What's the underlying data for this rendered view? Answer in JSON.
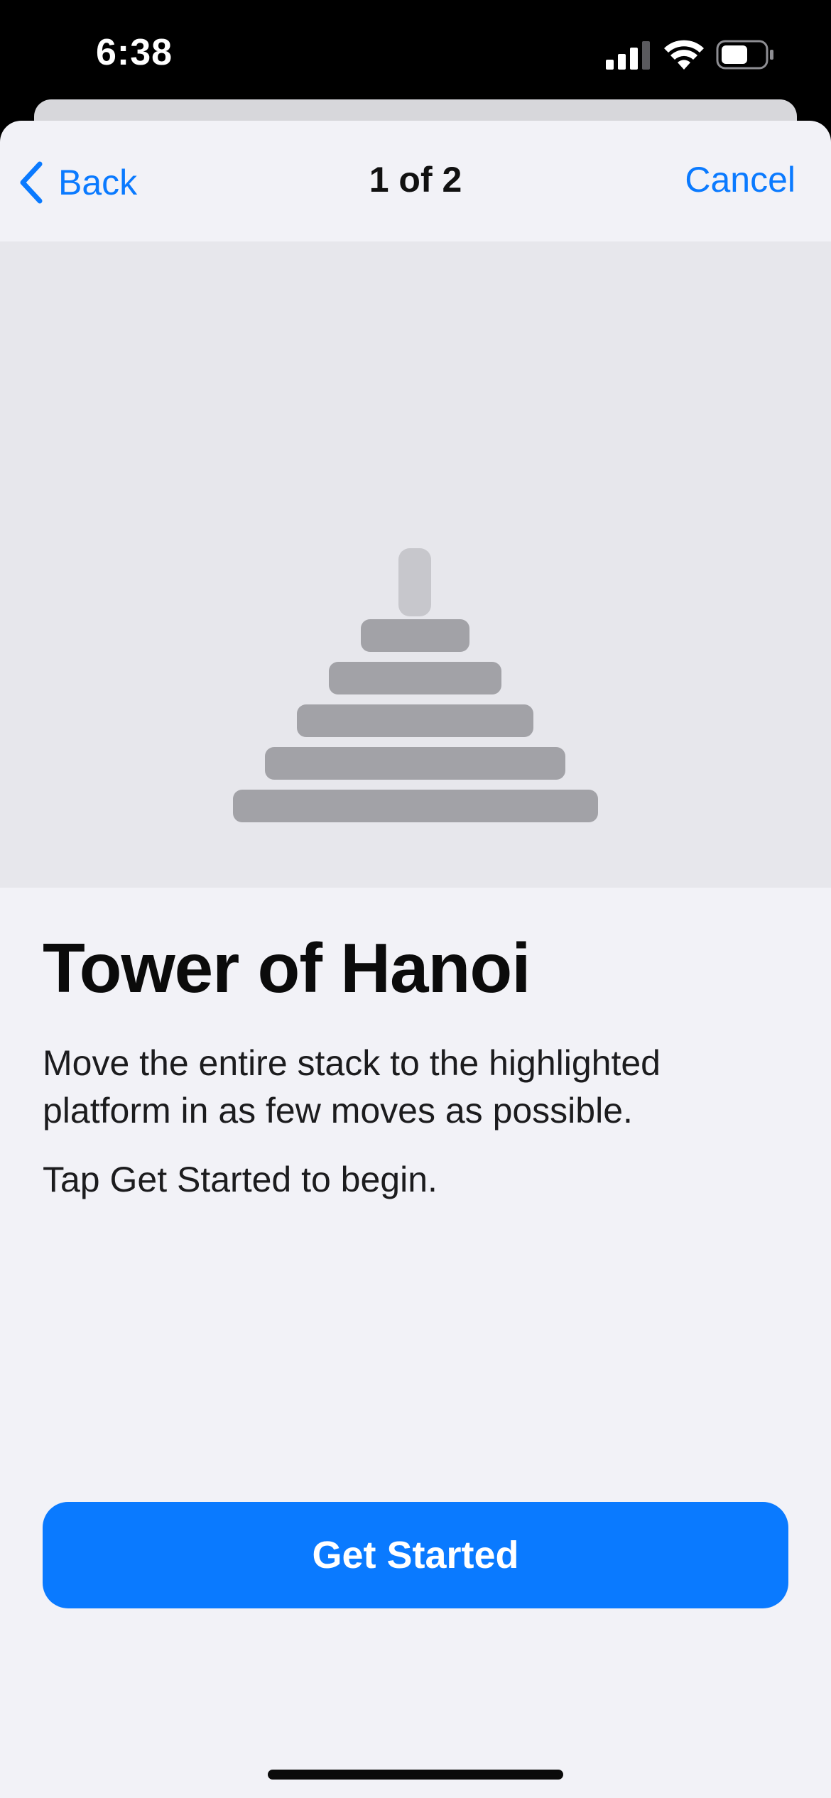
{
  "status_bar": {
    "time": "6:38",
    "icons": [
      "cellular-signal-icon",
      "wifi-icon",
      "battery-icon"
    ]
  },
  "nav": {
    "back_label": "Back",
    "title": "1 of 2",
    "cancel_label": "Cancel"
  },
  "illustration": {
    "icon": "tower-of-hanoi-icon",
    "disk_count": 5
  },
  "content": {
    "title": "Tower of Hanoi",
    "description": "Move the entire stack to the highlighted platform in as few moves as possible.",
    "hint": "Tap Get Started to begin."
  },
  "actions": {
    "primary_label": "Get Started"
  },
  "colors": {
    "accent": "#0a7aff",
    "sheet_background": "#f2f2f7",
    "illustration_background": "#e7e7ec",
    "disk": "#a2a2a7",
    "peg": "#c7c7cc"
  }
}
